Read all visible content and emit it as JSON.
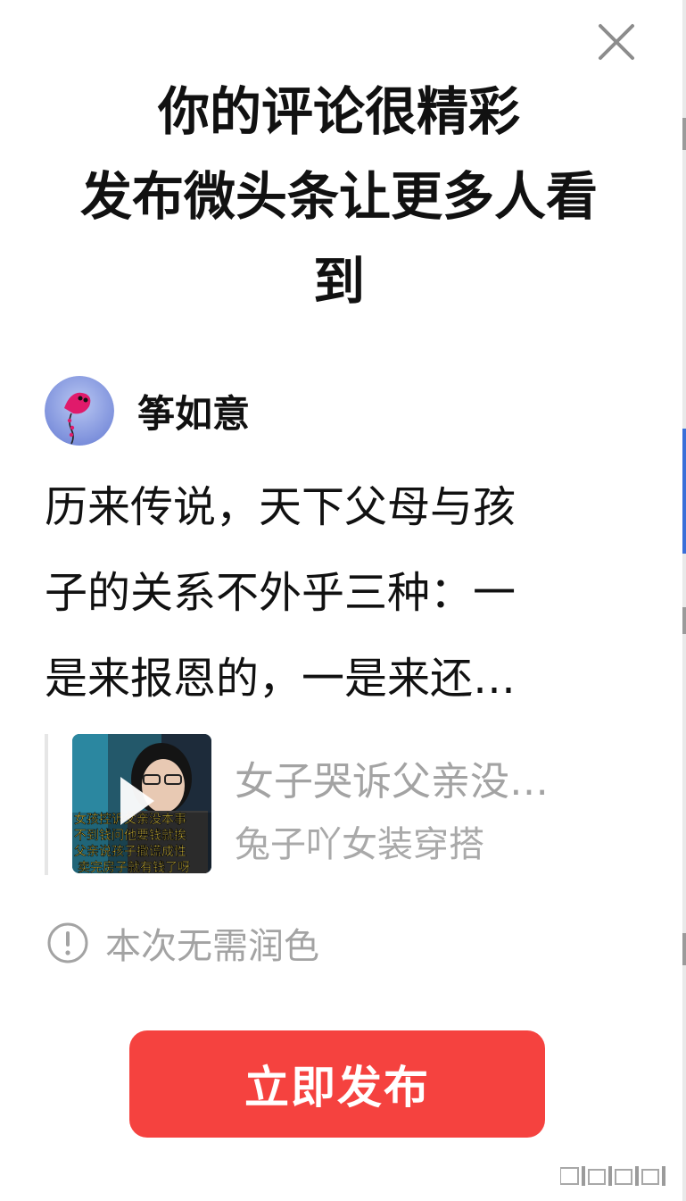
{
  "dialog": {
    "headline_lines": [
      "你的评论很精彩",
      "发布微头条让更多人看",
      "到"
    ],
    "close_icon": "close-icon"
  },
  "author": {
    "name": "筝如意",
    "avatar_icon": "kite-avatar"
  },
  "comment": {
    "lines": [
      "历来传说，天下父母与孩",
      "子的关系不外乎三种：一",
      "是来报恩的，一是来还…"
    ]
  },
  "quoted_article": {
    "title": "女子哭诉父亲没…",
    "author": "兔子吖女装穿搭",
    "thumbnail_caption_lines": [
      "女孩控诉父亲没本事",
      "不到钱问他要钱就挨",
      "父亲说孩子撒谎成性",
      "卖完房子就有钱了呀"
    ],
    "play_icon": "play-icon"
  },
  "notice": {
    "icon": "info-circle-icon",
    "text": "本次无需润色"
  },
  "actions": {
    "publish_label": "立即发布",
    "publish_color": "#f5423f"
  },
  "colors": {
    "headline": "#111111",
    "muted": "#a3a3a3"
  }
}
